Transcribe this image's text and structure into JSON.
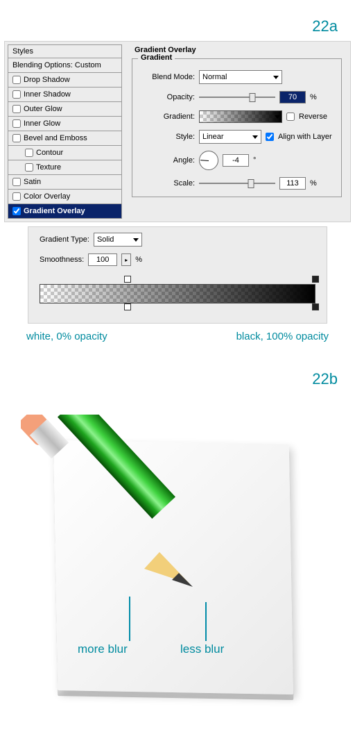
{
  "labels": {
    "step_a": "22a",
    "step_b": "22b"
  },
  "styles": {
    "header": "Styles",
    "blending": "Blending Options: Custom",
    "items": [
      {
        "label": "Drop Shadow",
        "checked": false,
        "sub": false,
        "active": false
      },
      {
        "label": "Inner Shadow",
        "checked": false,
        "sub": false,
        "active": false
      },
      {
        "label": "Outer Glow",
        "checked": false,
        "sub": false,
        "active": false
      },
      {
        "label": "Inner Glow",
        "checked": false,
        "sub": false,
        "active": false
      },
      {
        "label": "Bevel and Emboss",
        "checked": false,
        "sub": false,
        "active": false
      },
      {
        "label": "Contour",
        "checked": false,
        "sub": true,
        "active": false
      },
      {
        "label": "Texture",
        "checked": false,
        "sub": true,
        "active": false
      },
      {
        "label": "Satin",
        "checked": false,
        "sub": false,
        "active": false
      },
      {
        "label": "Color Overlay",
        "checked": false,
        "sub": false,
        "active": false
      },
      {
        "label": "Gradient Overlay",
        "checked": true,
        "sub": false,
        "active": true
      }
    ]
  },
  "overlay": {
    "section_title": "Gradient Overlay",
    "subsection_title": "Gradient",
    "blend_mode_label": "Blend Mode:",
    "blend_mode_value": "Normal",
    "opacity_label": "Opacity:",
    "opacity_value": "70",
    "opacity_pct": 70,
    "pct": "%",
    "gradient_label": "Gradient:",
    "reverse_label": "Reverse",
    "reverse_checked": false,
    "style_label": "Style:",
    "style_value": "Linear",
    "align_label": "Align with Layer",
    "align_checked": true,
    "angle_label": "Angle:",
    "angle_value": "-4",
    "degree": "°",
    "scale_label": "Scale:",
    "scale_value": "113",
    "scale_pct": 68
  },
  "editor": {
    "type_label": "Gradient Type:",
    "type_value": "Solid",
    "smooth_label": "Smoothness:",
    "smooth_value": "100",
    "pct": "%",
    "stops_top": [
      {
        "pos": 32
      },
      {
        "pos": 100
      }
    ],
    "stops_bot": [
      {
        "pos": 32
      },
      {
        "pos": 100
      }
    ]
  },
  "captions": {
    "left": "white, 0% opacity",
    "right": "black, 100% opacity"
  },
  "illus": {
    "more": "more blur",
    "less": "less blur"
  }
}
